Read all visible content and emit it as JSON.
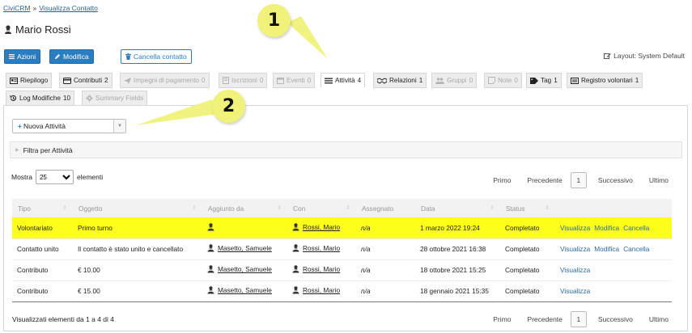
{
  "breadcrumb": {
    "home": "CiviCRM",
    "separator": "»",
    "current": "Visualizza Contatto"
  },
  "contact": {
    "name": "Mario Rossi"
  },
  "toolbar": {
    "actions_label": "Azioni",
    "edit_label": "Modifica",
    "delete_label": "Cancella contatto",
    "layout_label": "Layout: System Default"
  },
  "tabs": [
    {
      "label": "Riepilogo",
      "count": "",
      "icon": "summary-icon"
    },
    {
      "label": "Contributi",
      "count": "2",
      "icon": "credit-card-icon"
    },
    {
      "label": "Impegni di pagamento",
      "count": "0",
      "icon": "paper-plane-icon"
    },
    {
      "label": "Iscrizioni",
      "count": "0",
      "icon": "membership-icon"
    },
    {
      "label": "Eventi",
      "count": "0",
      "icon": "calendar-icon"
    },
    {
      "label": "Attività",
      "count": "4",
      "icon": "list-icon"
    },
    {
      "label": "Relazioni",
      "count": "1",
      "icon": "handshake-icon"
    },
    {
      "label": "Gruppi",
      "count": "0",
      "icon": "users-icon"
    },
    {
      "label": "Note",
      "count": "0",
      "icon": "note-icon"
    },
    {
      "label": "Tag",
      "count": "1",
      "icon": "tag-icon"
    },
    {
      "label": "Registro volontari",
      "count": "1",
      "icon": "register-icon"
    },
    {
      "label": "Log Modifiche",
      "count": "10",
      "icon": "history-icon"
    },
    {
      "label": "Summary Fields",
      "count": "",
      "icon": "gear-icon"
    }
  ],
  "new_activity": {
    "label": "Nuova Attività"
  },
  "filter": {
    "label": "Filtra per Attività"
  },
  "length_menu": {
    "before": "Mostra",
    "value": "25",
    "after": "elementi"
  },
  "pagination": {
    "first": "Primo",
    "previous": "Precedente",
    "current": "1",
    "next": "Successivo",
    "last": "Ultimo"
  },
  "table": {
    "headers": [
      "Tipo",
      "Oggetto",
      "Aggiunto da",
      "Con",
      "Assegnato",
      "Data",
      "Status",
      ""
    ],
    "rows": [
      {
        "type": "Volontariato",
        "subject": "Primo turno",
        "added_by": "",
        "with": "Rossi, Mario",
        "assigned": "n/a",
        "date": "1 marzo 2022 19:24",
        "status": "Completato",
        "actions": [
          "Visualizza",
          "Modifica",
          "Cancella"
        ]
      },
      {
        "type": "Contatto unito",
        "subject": "Il contatto è stato unito e cancellato",
        "added_by": "Masetto, Samuele",
        "with": "Rossi, Mario",
        "assigned": "n/a",
        "date": "28 ottobre 2021 16:38",
        "status": "Completato",
        "actions": [
          "Visualizza",
          "Modifica",
          "Cancella"
        ]
      },
      {
        "type": "Contributo",
        "subject": "€ 10.00",
        "added_by": "Masetto, Samuele",
        "with": "Rossi, Mario",
        "assigned": "n/a",
        "date": "18 ottobre 2021 15:25",
        "status": "Completato",
        "actions": [
          "Visualizza"
        ]
      },
      {
        "type": "Contributo",
        "subject": "€ 15.00",
        "added_by": "Masetto, Samuele",
        "with": "Rossi, Mario",
        "assigned": "n/a",
        "date": "18 gennaio 2021 15:35",
        "status": "Completato",
        "actions": [
          "Visualizza"
        ]
      }
    ]
  },
  "info": {
    "text": "Visualizzati elementi da 1 a 4 di 4"
  },
  "callouts": [
    "1",
    "2"
  ],
  "colors": {
    "primary": "#2b7dc1",
    "highlight": "#ffff1c",
    "callout": "#f0f27a"
  }
}
